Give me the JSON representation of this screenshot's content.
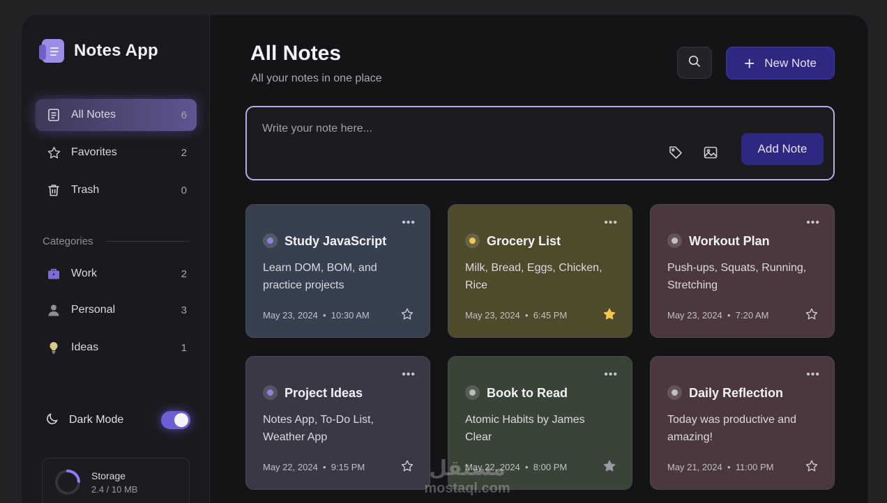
{
  "app": {
    "title": "Notes App"
  },
  "nav": [
    {
      "label": "All Notes",
      "count": "6",
      "icon": "note-icon",
      "active": true
    },
    {
      "label": "Favorites",
      "count": "2",
      "icon": "star-icon",
      "active": false
    },
    {
      "label": "Trash",
      "count": "0",
      "icon": "trash-icon",
      "active": false
    }
  ],
  "categories": {
    "header": "Categories",
    "items": [
      {
        "label": "Work",
        "count": "2",
        "icon": "briefcase-icon"
      },
      {
        "label": "Personal",
        "count": "3",
        "icon": "person-icon"
      },
      {
        "label": "Ideas",
        "count": "1",
        "icon": "lightbulb-icon"
      }
    ]
  },
  "dark_mode": {
    "label": "Dark Mode",
    "enabled": true
  },
  "storage": {
    "label": "Storage",
    "usage": "2.4 / 10 MB",
    "fraction": 0.24
  },
  "header": {
    "title": "All Notes",
    "subtitle": "All your notes in one place",
    "new_note_label": "New Note"
  },
  "composer": {
    "placeholder": "Write your note here...",
    "add_label": "Add Note"
  },
  "notes": [
    {
      "title": "Study JavaScript",
      "body": "Learn DOM, BOM, and practice projects",
      "date": "May 23, 2024",
      "time": "10:30 AM",
      "favorite": false,
      "color": "#37404f",
      "dot": "#8f82dc"
    },
    {
      "title": "Grocery List",
      "body": "Milk, Bread, Eggs, Chicken, Rice",
      "date": "May 23, 2024",
      "time": "6:45 PM",
      "favorite": true,
      "color": "#4f4a2c",
      "dot": "#f2c94c"
    },
    {
      "title": "Workout Plan",
      "body": "Push-ups, Squats, Running, Stretching",
      "date": "May 23, 2024",
      "time": "7:20 AM",
      "favorite": false,
      "color": "#4a383c",
      "dot": "#c4c0c0"
    },
    {
      "title": "Project Ideas",
      "body": "Notes App, To-Do List, Weather App",
      "date": "May 22, 2024",
      "time": "9:15 PM",
      "favorite": false,
      "color": "#3b3747",
      "dot": "#8f82dc"
    },
    {
      "title": "Book to Read",
      "body": "Atomic Habits by James Clear",
      "date": "May 22, 2024",
      "time": "8:00 PM",
      "favorite": true,
      "color": "#3a4436",
      "dot": "#bcbcbc"
    },
    {
      "title": "Daily Reflection",
      "body": "Today was productive and amazing!",
      "date": "May 21, 2024",
      "time": "11:00 PM",
      "favorite": false,
      "color": "#4a383c",
      "dot": "#c4c0c0"
    }
  ],
  "watermark": {
    "arabic": "مستقل",
    "latin": "mostaql.com"
  },
  "colors": {
    "accent": "#6d5ed6",
    "button": "#2e2880",
    "background": "#141417"
  }
}
